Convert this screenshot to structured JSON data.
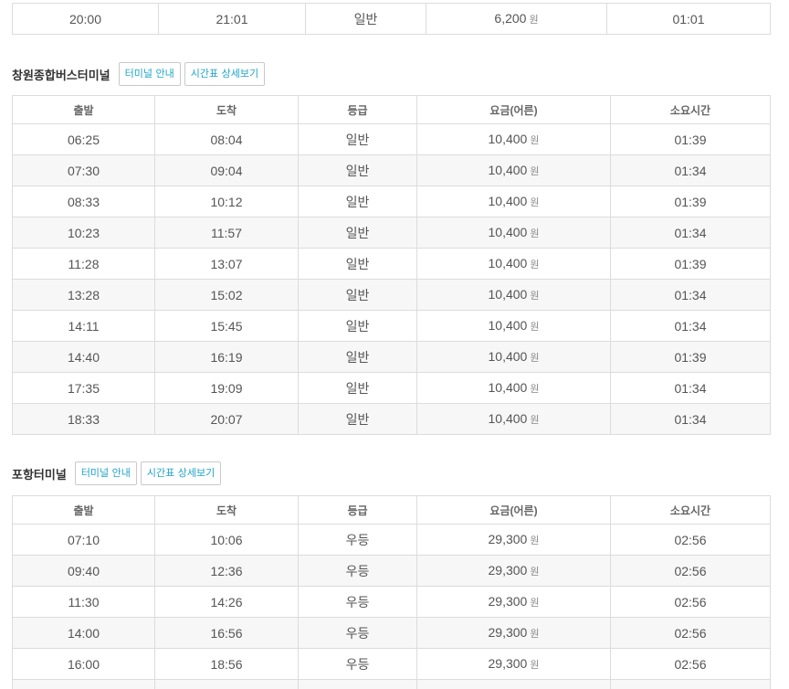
{
  "units": {
    "won": "원"
  },
  "prev_section": {
    "rows": [
      {
        "depart": "20:00",
        "arrive": "21:01",
        "grade": "일반",
        "fare": "6,200",
        "duration": "01:01"
      }
    ]
  },
  "sections": [
    {
      "title": "창원종합버스터미널",
      "btn_info": "터미널 안내",
      "btn_detail": "시간표 상세보기",
      "headers": [
        "출발",
        "도착",
        "등급",
        "요금(어른)",
        "소요시간"
      ],
      "rows": [
        {
          "depart": "06:25",
          "arrive": "08:04",
          "grade": "일반",
          "fare": "10,400",
          "duration": "01:39"
        },
        {
          "depart": "07:30",
          "arrive": "09:04",
          "grade": "일반",
          "fare": "10,400",
          "duration": "01:34"
        },
        {
          "depart": "08:33",
          "arrive": "10:12",
          "grade": "일반",
          "fare": "10,400",
          "duration": "01:39"
        },
        {
          "depart": "10:23",
          "arrive": "11:57",
          "grade": "일반",
          "fare": "10,400",
          "duration": "01:34"
        },
        {
          "depart": "11:28",
          "arrive": "13:07",
          "grade": "일반",
          "fare": "10,400",
          "duration": "01:39"
        },
        {
          "depart": "13:28",
          "arrive": "15:02",
          "grade": "일반",
          "fare": "10,400",
          "duration": "01:34"
        },
        {
          "depart": "14:11",
          "arrive": "15:45",
          "grade": "일반",
          "fare": "10,400",
          "duration": "01:34"
        },
        {
          "depart": "14:40",
          "arrive": "16:19",
          "grade": "일반",
          "fare": "10,400",
          "duration": "01:39"
        },
        {
          "depart": "17:35",
          "arrive": "19:09",
          "grade": "일반",
          "fare": "10,400",
          "duration": "01:34"
        },
        {
          "depart": "18:33",
          "arrive": "20:07",
          "grade": "일반",
          "fare": "10,400",
          "duration": "01:34"
        }
      ]
    },
    {
      "title": "포항터미널",
      "btn_info": "터미널 안내",
      "btn_detail": "시간표 상세보기",
      "headers": [
        "출발",
        "도착",
        "등급",
        "요금(어른)",
        "소요시간"
      ],
      "rows": [
        {
          "depart": "07:10",
          "arrive": "10:06",
          "grade": "우등",
          "fare": "29,300",
          "duration": "02:56"
        },
        {
          "depart": "09:40",
          "arrive": "12:36",
          "grade": "우등",
          "fare": "29,300",
          "duration": "02:56"
        },
        {
          "depart": "11:30",
          "arrive": "14:26",
          "grade": "우등",
          "fare": "29,300",
          "duration": "02:56"
        },
        {
          "depart": "14:00",
          "arrive": "16:56",
          "grade": "우등",
          "fare": "29,300",
          "duration": "02:56"
        },
        {
          "depart": "16:00",
          "arrive": "18:56",
          "grade": "우등",
          "fare": "29,300",
          "duration": "02:56"
        },
        {
          "depart": "",
          "arrive": "",
          "grade": "",
          "fare": "",
          "duration": ""
        }
      ]
    }
  ]
}
